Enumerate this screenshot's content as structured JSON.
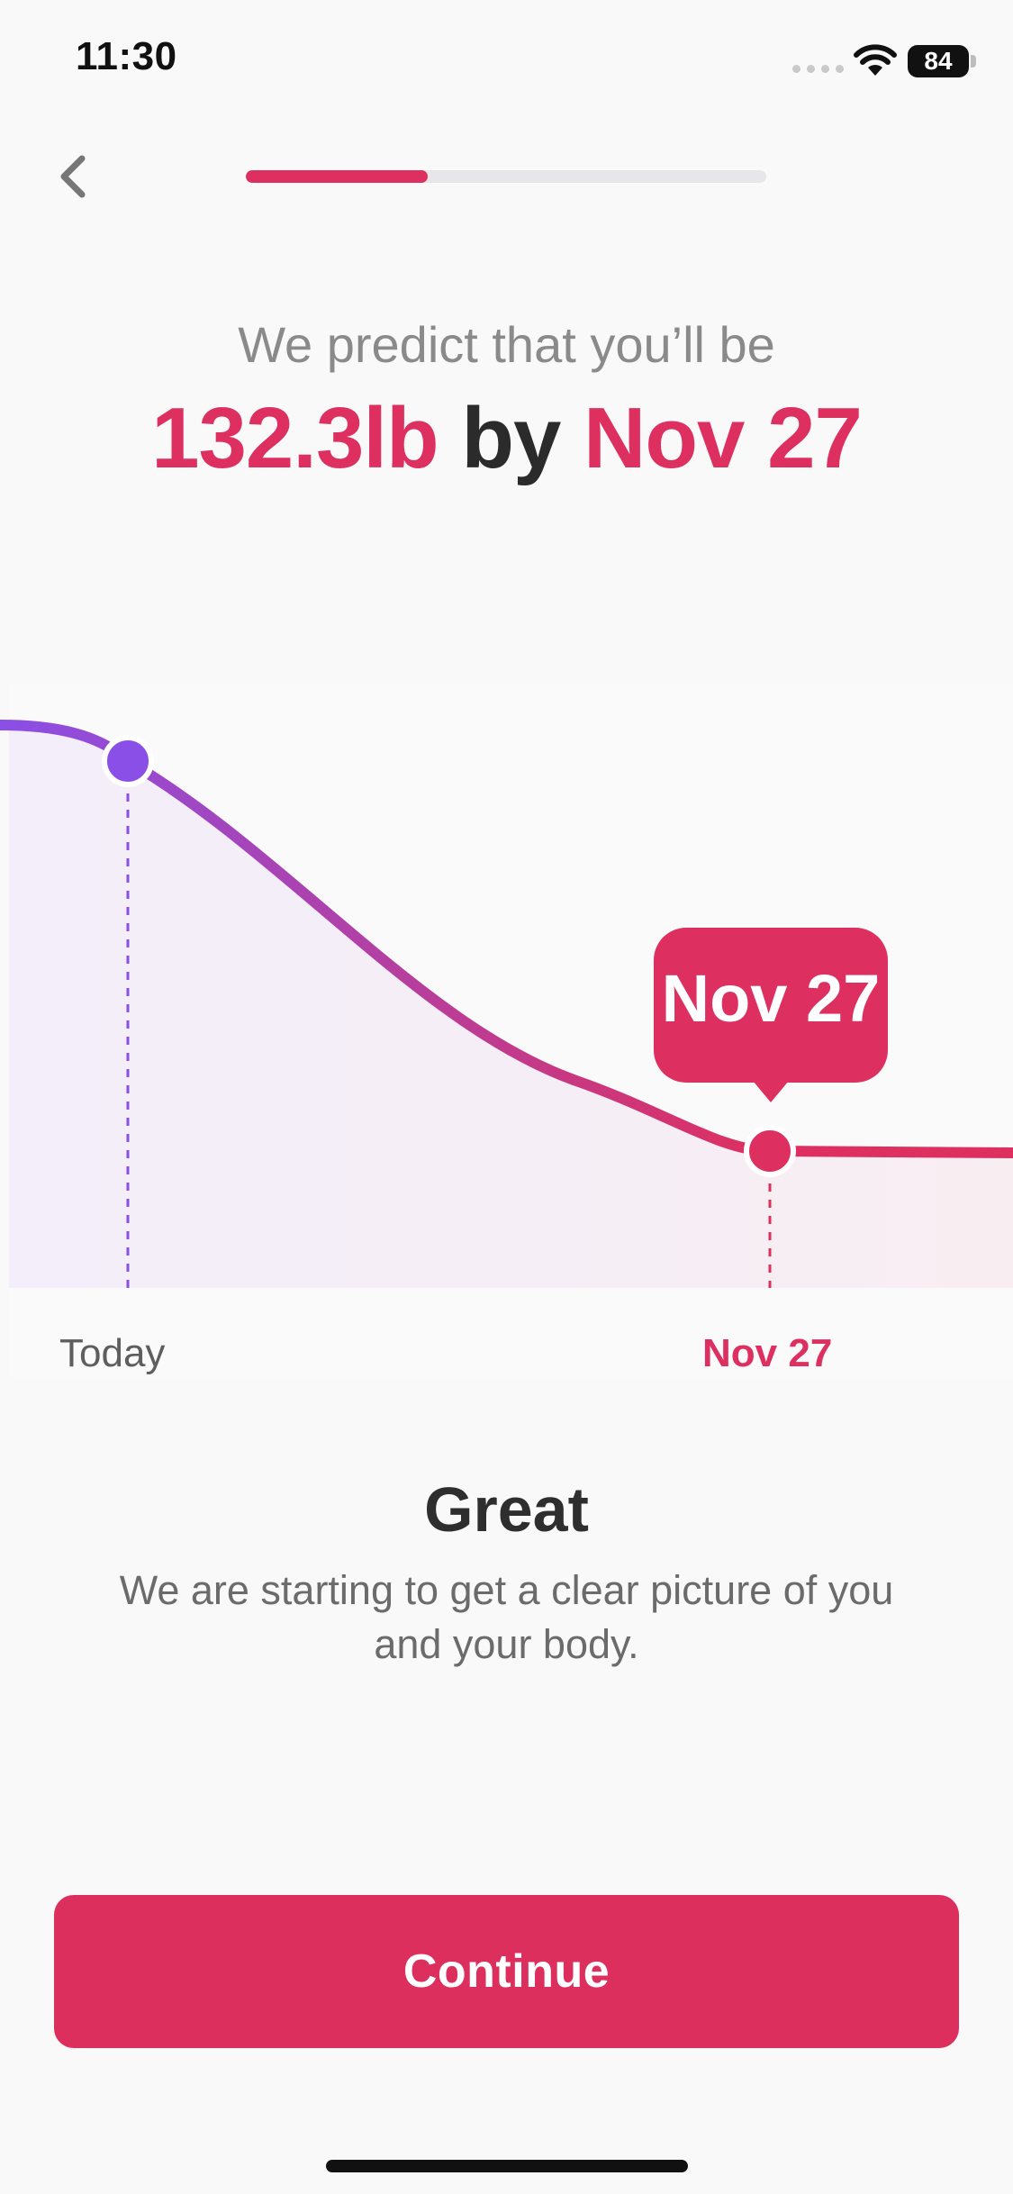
{
  "status_bar": {
    "time": "11:30",
    "battery": "84"
  },
  "progress": {
    "fraction": 0.35
  },
  "headline": {
    "prefix": "We predict that you’ll be",
    "weight": "132.3lb",
    "connector": "by",
    "date": "Nov 27"
  },
  "chart_data": {
    "type": "area",
    "x_labels": {
      "start": "Today",
      "end": "Nov 27"
    },
    "callout": "Nov 27",
    "colors": {
      "start": "#8a4fe6",
      "end": "#dd3060"
    }
  },
  "message": {
    "title": "Great",
    "body": "We are starting to get a clear picture of you and your body."
  },
  "continue_label": "Continue",
  "colors": {
    "accent": "#dd3060",
    "purple": "#8a4fe6"
  }
}
